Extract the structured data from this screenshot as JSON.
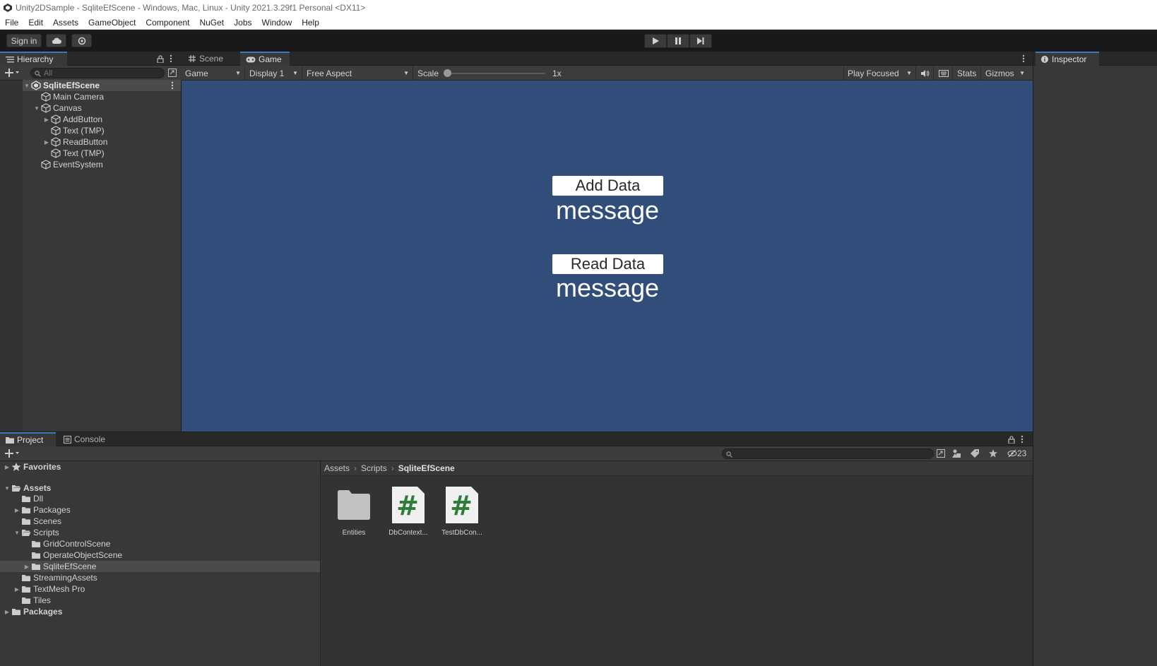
{
  "window": {
    "title": "Unity2DSample - SqliteEfScene - Windows, Mac, Linux - Unity 2021.3.29f1 Personal <DX11>"
  },
  "menu": [
    "File",
    "Edit",
    "Assets",
    "GameObject",
    "Component",
    "NuGet",
    "Jobs",
    "Window",
    "Help"
  ],
  "toolbar": {
    "sign_in": "Sign in"
  },
  "hierarchy": {
    "tab_label": "Hierarchy",
    "search_placeholder": "All",
    "items": [
      {
        "label": "SqliteEfScene"
      },
      {
        "label": "Main Camera"
      },
      {
        "label": "Canvas"
      },
      {
        "label": "AddButton"
      },
      {
        "label": "Text (TMP)"
      },
      {
        "label": "ReadButton"
      },
      {
        "label": "Text (TMP)"
      },
      {
        "label": "EventSystem"
      }
    ]
  },
  "game_view": {
    "tabs": [
      "Scene",
      "Game"
    ],
    "mode": "Game",
    "display": "Display 1",
    "aspect": "Free Aspect",
    "scale_label": "Scale",
    "scale_value": "1x",
    "play_focused": "Play Focused",
    "stats": "Stats",
    "gizmos": "Gizmos",
    "canvas_color": "#314d79",
    "add_button_label": "Add Data",
    "add_message": "message",
    "read_button_label": "Read Data",
    "read_message": "message"
  },
  "inspector": {
    "tab_label": "Inspector"
  },
  "project": {
    "tabs": [
      "Project",
      "Console"
    ],
    "hidden_count": "23",
    "tree": [
      {
        "label": "Favorites"
      },
      {
        "label": "Assets"
      },
      {
        "label": "Dll"
      },
      {
        "label": "Packages"
      },
      {
        "label": "Scenes"
      },
      {
        "label": "Scripts"
      },
      {
        "label": "GridControlScene"
      },
      {
        "label": "OperateObjectScene"
      },
      {
        "label": "SqliteEfScene"
      },
      {
        "label": "StreamingAssets"
      },
      {
        "label": "TextMesh Pro"
      },
      {
        "label": "Tiles"
      },
      {
        "label": "Packages"
      }
    ],
    "breadcrumb": [
      "Assets",
      "Scripts",
      "SqliteEfScene"
    ],
    "assets": [
      {
        "label": "Entities",
        "icon": "folder-icon"
      },
      {
        "label": "DbContext...",
        "icon": "csharp-script-icon"
      },
      {
        "label": "TestDbCon...",
        "icon": "csharp-script-icon"
      }
    ]
  }
}
